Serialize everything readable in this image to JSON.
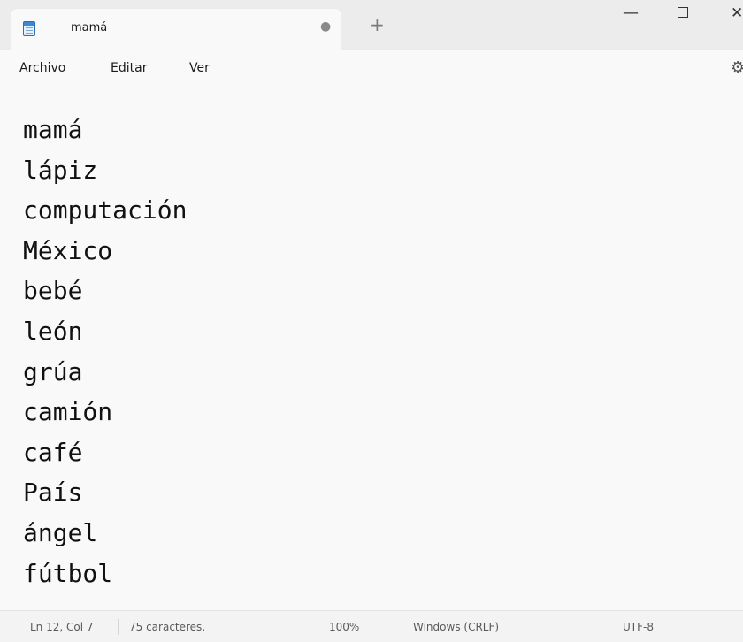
{
  "tab": {
    "title": "mamá",
    "unsaved_indicator": "●",
    "new_tab_label": "+"
  },
  "window_controls": {
    "minimize": "—",
    "close": "✕"
  },
  "menu": {
    "file": "Archivo",
    "edit": "Editar",
    "view": "Ver",
    "settings_icon": "⚙"
  },
  "document": {
    "lines": [
      "mamá",
      "lápiz",
      "computación",
      "México",
      "bebé",
      "león",
      "grúa",
      "camión",
      "café",
      "País",
      "ángel",
      "fútbol"
    ]
  },
  "status": {
    "position": "Ln 12, Col 7",
    "characters": "75 caracteres.",
    "zoom": "100%",
    "line_ending": "Windows (CRLF)",
    "encoding": "UTF-8"
  },
  "icons": {
    "app": "notepad-icon",
    "settings": "gear-icon"
  }
}
